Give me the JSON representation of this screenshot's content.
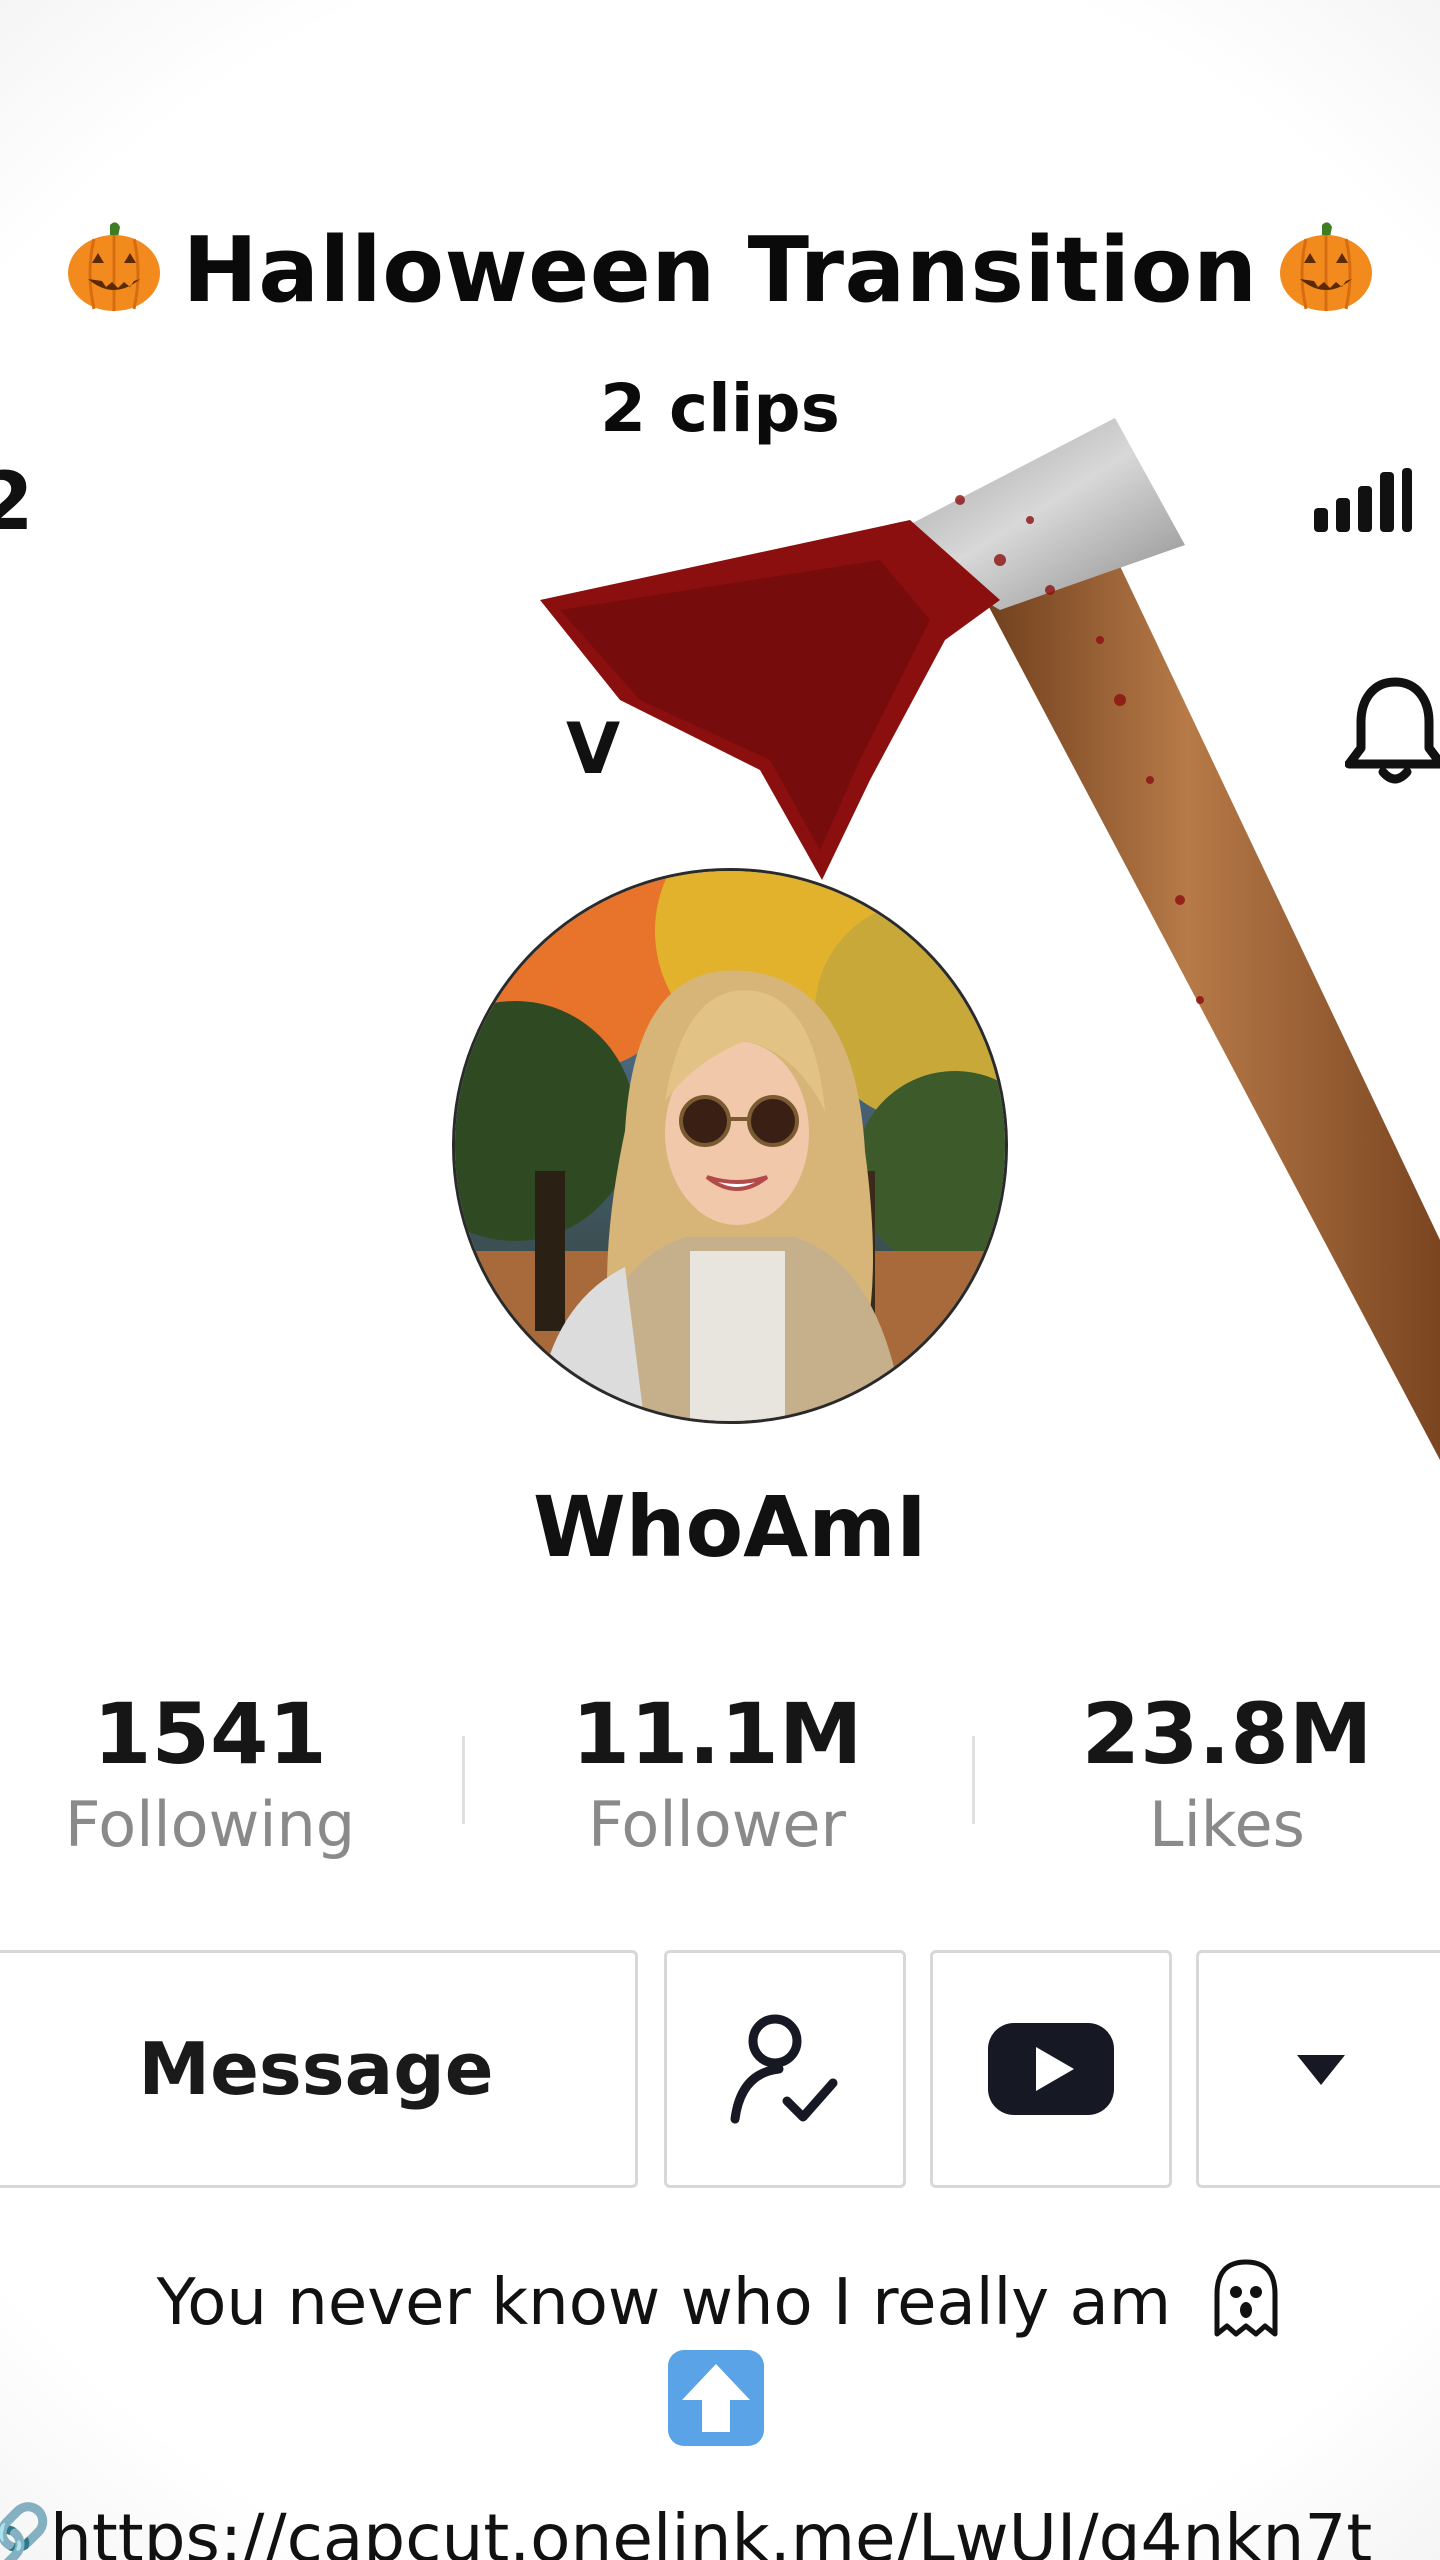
{
  "overlay": {
    "title": "Halloween Transition",
    "subtitle": "2 clips"
  },
  "status_bar": {
    "time_fragment": "2"
  },
  "header": {
    "partial_text": "V"
  },
  "profile": {
    "username": "WhoAmI",
    "bio": "You never know who I really am",
    "link": "https://capcut.onelink.me/LwUJ/g4nkn7t"
  },
  "stats": [
    {
      "value": "1541",
      "label": "Following"
    },
    {
      "value": "11.1M",
      "label": "Follower"
    },
    {
      "value": "23.8M",
      "label": "Likes"
    }
  ],
  "actions": {
    "message_label": "Message",
    "icons": [
      "user-check-icon",
      "youtube-icon",
      "dropdown-arrow-icon"
    ]
  },
  "colors": {
    "pumpkin": "#f28a1e",
    "blood": "#8b0f0f",
    "youtube_button": "#161823"
  }
}
